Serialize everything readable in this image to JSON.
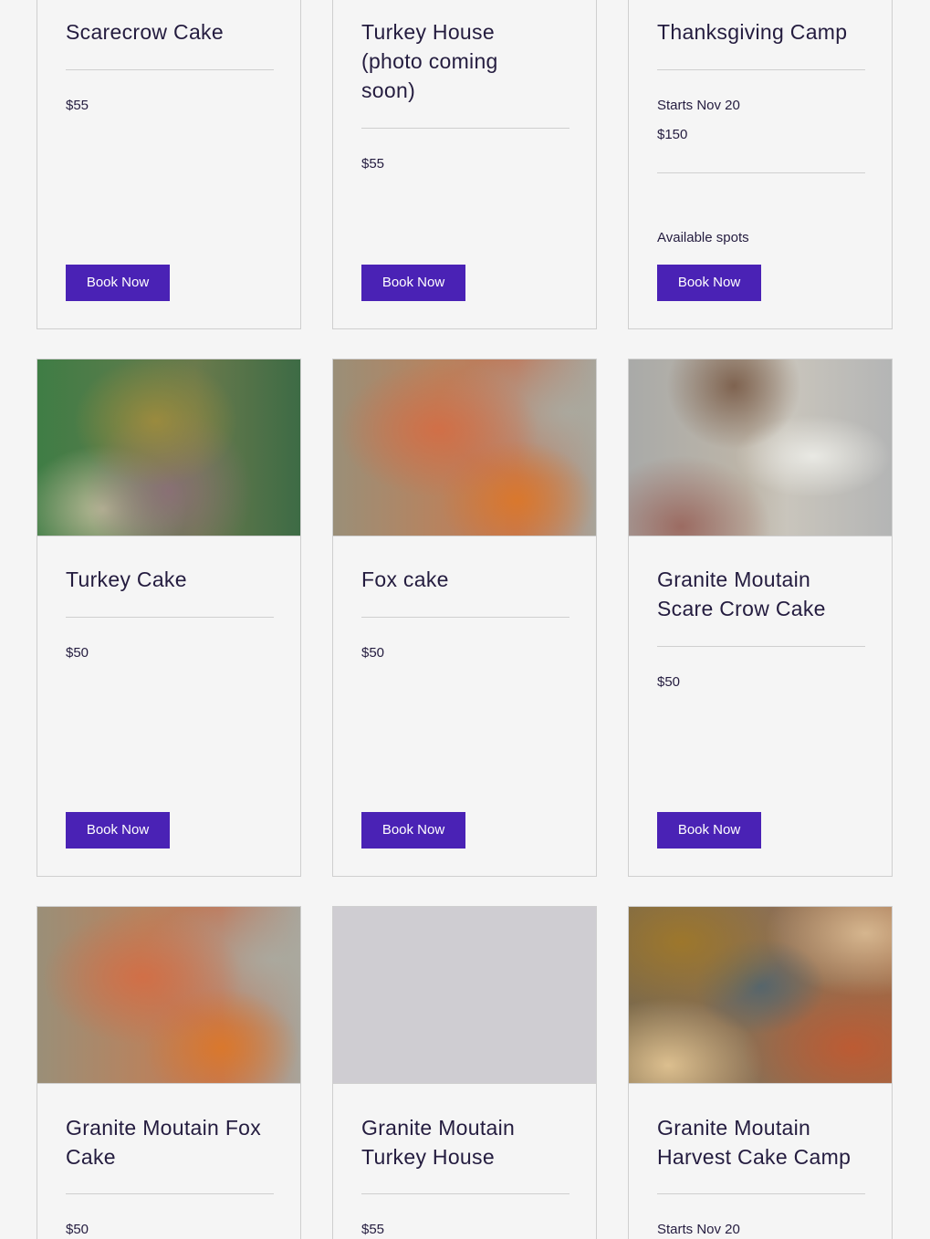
{
  "colors": {
    "background": "#f5f5f5",
    "title_text": "#241c3f",
    "button_bg": "#4a22b5",
    "button_text": "#ffffff",
    "border": "#cfcfcf"
  },
  "cards": [
    {
      "title": "Scarecrow Cake",
      "price": "$55",
      "button": "Book Now"
    },
    {
      "title": "Turkey House (photo coming soon)",
      "price": "$55",
      "button": "Book Now"
    },
    {
      "title": "Thanksgiving Camp",
      "start": "Starts Nov 20",
      "price": "$150",
      "availability": "Available spots",
      "button": "Book Now"
    },
    {
      "title": "Turkey Cake",
      "price": "$50",
      "button": "Book Now",
      "image": "turkey-cake-photo"
    },
    {
      "title": "Fox cake",
      "price": "$50",
      "button": "Book Now",
      "image": "fox-cake-photo"
    },
    {
      "title": "Granite Moutain Scare Crow Cake",
      "price": "$50",
      "button": "Book Now",
      "image": "scarecrow-cake-photo"
    },
    {
      "title": "Granite Moutain Fox Cake",
      "price": "$50",
      "image": "fox-cake-photo"
    },
    {
      "title": "Granite Moutain Turkey House",
      "price": "$55",
      "image": "image-placeholder"
    },
    {
      "title": "Granite Moutain Harvest Cake Camp",
      "start": "Starts Nov 20",
      "image": "harvest-cake-photo"
    }
  ]
}
